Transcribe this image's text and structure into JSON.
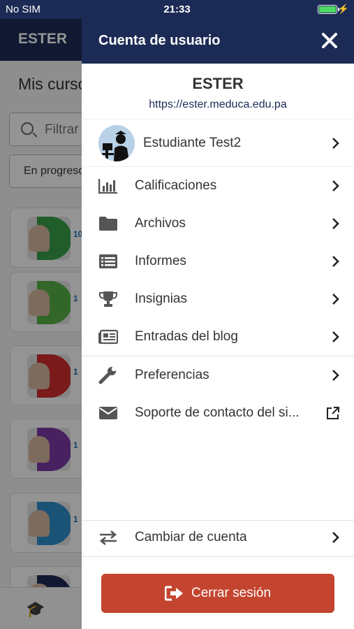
{
  "status_bar": {
    "carrier": "No SIM",
    "time": "21:33"
  },
  "background": {
    "header_title": "ESTER",
    "page_title": "Mis cursos",
    "filter_placeholder": "Filtrar",
    "select_value": "En progreso",
    "cards": [
      {
        "num": "10",
        "color": "#3aa14a"
      },
      {
        "num": "1",
        "color": "#57b248"
      },
      {
        "num": "1",
        "color": "#d22d2d"
      },
      {
        "num": "1",
        "color": "#7c3aa6"
      },
      {
        "num": "1",
        "color": "#2f8fce"
      },
      {
        "num": "",
        "color": "#1c2b55"
      }
    ]
  },
  "drawer": {
    "title": "Cuenta de usuario",
    "site_name": "ESTER",
    "site_url": "https://ester.meduca.edu.pa",
    "user_name": "Estudiante Test2",
    "items": [
      {
        "label": "Calificaciones",
        "icon": "bar-chart-icon"
      },
      {
        "label": "Archivos",
        "icon": "folder-icon"
      },
      {
        "label": "Informes",
        "icon": "list-icon"
      },
      {
        "label": "Insignias",
        "icon": "trophy-icon"
      },
      {
        "label": "Entradas del blog",
        "icon": "newspaper-icon"
      }
    ],
    "items2": [
      {
        "label": "Preferencias",
        "icon": "wrench-icon"
      },
      {
        "label": "Soporte de contacto del si...",
        "icon": "envelope-icon"
      }
    ],
    "switch_account": "Cambiar de cuenta",
    "logout": "Cerrar sesión"
  },
  "colors": {
    "header": "#1c2b55",
    "logout": "#c4452f",
    "battery": "#4cd964"
  }
}
